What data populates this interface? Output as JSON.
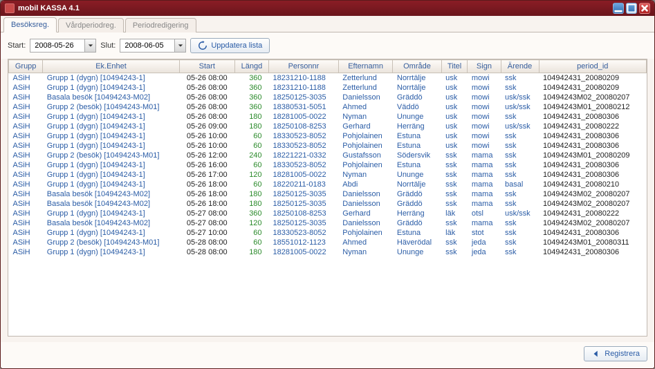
{
  "window": {
    "title": "mobil KASSA 4.1"
  },
  "tabs": [
    {
      "label": "Besöksreg."
    },
    {
      "label": "Vårdperiodreg."
    },
    {
      "label": "Periodredigering"
    }
  ],
  "toolbar": {
    "start_label": "Start:",
    "start_value": "2008-05-26",
    "slut_label": "Slut:",
    "slut_value": "2008-06-05",
    "update_label": "Uppdatera lista"
  },
  "columns": [
    "Grupp",
    "Ek.Enhet",
    "Start",
    "Längd",
    "Personnr",
    "Efternamn",
    "Område",
    "Titel",
    "Sign",
    "Ärende",
    "period_id"
  ],
  "rows": [
    [
      "ASiH",
      "Grupp 1 (dygn) [10494243-1]",
      "05-26 08:00",
      "360",
      "18231210-1188",
      "Zetterlund",
      "Norrtälje",
      "usk",
      "mowi",
      "ssk",
      "104942431_20080209"
    ],
    [
      "ASiH",
      "Grupp 1 (dygn) [10494243-1]",
      "05-26 08:00",
      "360",
      "18231210-1188",
      "Zetterlund",
      "Norrtälje",
      "usk",
      "mowi",
      "ssk",
      "104942431_20080209"
    ],
    [
      "ASiH",
      "Basala besök [10494243-M02]",
      "05-26 08:00",
      "360",
      "18250125-3035",
      "Danielsson",
      "Gräddö",
      "usk",
      "mowi",
      "usk/ssk",
      "10494243M02_20080207"
    ],
    [
      "ASiH",
      "Grupp 2 (besök) [10494243-M01]",
      "05-26 08:00",
      "360",
      "18380531-5051",
      "Ahmed",
      "Väddö",
      "usk",
      "mowi",
      "usk/ssk",
      "10494243M01_20080212"
    ],
    [
      "ASiH",
      "Grupp 1 (dygn) [10494243-1]",
      "05-26 08:00",
      "180",
      "18281005-0022",
      "Nyman",
      "Ununge",
      "usk",
      "mowi",
      "ssk",
      "104942431_20080306"
    ],
    [
      "ASiH",
      "Grupp 1 (dygn) [10494243-1]",
      "05-26 09:00",
      "180",
      "18250108-8253",
      "Gerhard",
      "Herräng",
      "usk",
      "mowi",
      "usk/ssk",
      "104942431_20080222"
    ],
    [
      "ASiH",
      "Grupp 1 (dygn) [10494243-1]",
      "05-26 10:00",
      "60",
      "18330523-8052",
      "Pohjolainen",
      "Estuna",
      "usk",
      "mowi",
      "ssk",
      "104942431_20080306"
    ],
    [
      "ASiH",
      "Grupp 1 (dygn) [10494243-1]",
      "05-26 10:00",
      "60",
      "18330523-8052",
      "Pohjolainen",
      "Estuna",
      "usk",
      "mowi",
      "ssk",
      "104942431_20080306"
    ],
    [
      "ASiH",
      "Grupp 2 (besök) [10494243-M01]",
      "05-26 12:00",
      "240",
      "18221221-0332",
      "Gustafsson",
      "Södersvik",
      "ssk",
      "mama",
      "ssk",
      "10494243M01_20080209"
    ],
    [
      "ASiH",
      "Grupp 1 (dygn) [10494243-1]",
      "05-26 16:00",
      "60",
      "18330523-8052",
      "Pohjolainen",
      "Estuna",
      "ssk",
      "mama",
      "ssk",
      "104942431_20080306"
    ],
    [
      "ASiH",
      "Grupp 1 (dygn) [10494243-1]",
      "05-26 17:00",
      "120",
      "18281005-0022",
      "Nyman",
      "Ununge",
      "ssk",
      "mama",
      "ssk",
      "104942431_20080306"
    ],
    [
      "ASiH",
      "Grupp 1 (dygn) [10494243-1]",
      "05-26 18:00",
      "60",
      "18220211-0183",
      "Abdi",
      "Norrtälje",
      "ssk",
      "mama",
      "basal",
      "104942431_20080210"
    ],
    [
      "ASiH",
      "Basala besök [10494243-M02]",
      "05-26 18:00",
      "180",
      "18250125-3035",
      "Danielsson",
      "Gräddö",
      "ssk",
      "mama",
      "ssk",
      "10494243M02_20080207"
    ],
    [
      "ASiH",
      "Basala besök [10494243-M02]",
      "05-26 18:00",
      "180",
      "18250125-3035",
      "Danielsson",
      "Gräddö",
      "ssk",
      "mama",
      "ssk",
      "10494243M02_20080207"
    ],
    [
      "ASiH",
      "Grupp 1 (dygn) [10494243-1]",
      "05-27 08:00",
      "360",
      "18250108-8253",
      "Gerhard",
      "Herräng",
      "läk",
      "otsl",
      "usk/ssk",
      "104942431_20080222"
    ],
    [
      "ASiH",
      "Basala besök [10494243-M02]",
      "05-27 08:00",
      "120",
      "18250125-3035",
      "Danielsson",
      "Gräddö",
      "ssk",
      "mama",
      "ssk",
      "10494243M02_20080207"
    ],
    [
      "ASiH",
      "Grupp 1 (dygn) [10494243-1]",
      "05-27 10:00",
      "60",
      "18330523-8052",
      "Pohjolainen",
      "Estuna",
      "läk",
      "stot",
      "ssk",
      "104942431_20080306"
    ],
    [
      "ASiH",
      "Grupp 2 (besök) [10494243-M01]",
      "05-28 08:00",
      "60",
      "18551012-1123",
      "Ahmed",
      "Häverödal",
      "ssk",
      "jeda",
      "ssk",
      "10494243M01_20080311"
    ],
    [
      "ASiH",
      "Grupp 1 (dygn) [10494243-1]",
      "05-28 08:00",
      "180",
      "18281005-0022",
      "Nyman",
      "Ununge",
      "ssk",
      "jeda",
      "ssk",
      "104942431_20080306"
    ]
  ],
  "footer": {
    "register_label": "Registrera"
  }
}
